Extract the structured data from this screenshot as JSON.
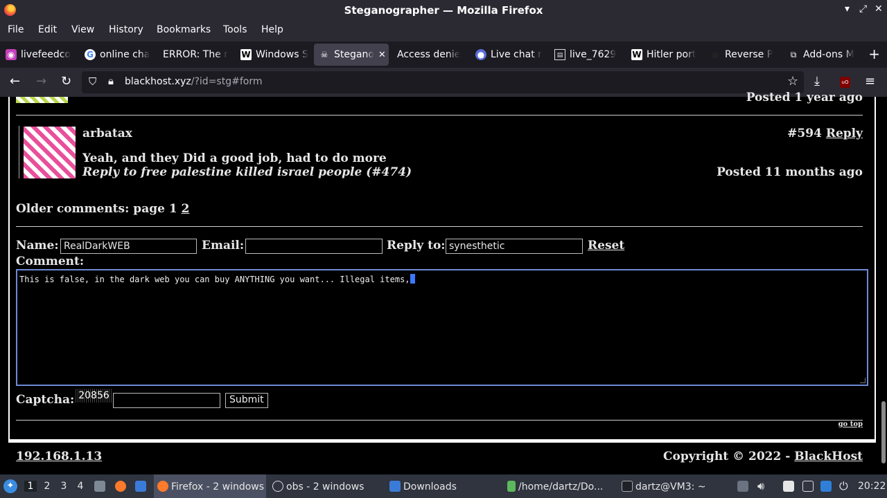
{
  "window": {
    "title": "Steganographer — Mozilla Firefox",
    "controls": [
      "▾",
      "⤢",
      "✕"
    ]
  },
  "menu": [
    "File",
    "Edit",
    "View",
    "History",
    "Bookmarks",
    "Tools",
    "Help"
  ],
  "tabs": [
    {
      "label": "livefeedco",
      "icon": "live-feed-icon"
    },
    {
      "label": "online cha",
      "icon": "google-icon"
    },
    {
      "label": "ERROR: The r",
      "icon": "none"
    },
    {
      "label": "Windows S",
      "icon": "wikipedia-icon"
    },
    {
      "label": "Stegano",
      "icon": "skull-icon",
      "active": true,
      "close": "✕"
    },
    {
      "label": "Access denie",
      "icon": "none"
    },
    {
      "label": "Live chat r",
      "icon": "chat-icon"
    },
    {
      "label": "live_7629",
      "icon": "page-icon"
    },
    {
      "label": "Hitler port",
      "icon": "wikipedia-icon"
    },
    {
      "label": "Reverse P",
      "icon": "user-icon"
    },
    {
      "label": "Add-ons M",
      "icon": "puzzle-icon"
    }
  ],
  "new_tab": "+",
  "url": {
    "host": "blackhost.xyz",
    "path": "/?id=stg#form"
  },
  "prev_post": {
    "posted": "Posted 1 year ago"
  },
  "post": {
    "author": "arbatax",
    "number": "#594",
    "reply": "Reply",
    "body": "Yeah, and they Did a good job, had to do more",
    "reply_to": "Reply to free palestine killed israel people (#474)",
    "posted": "Posted 11 months ago"
  },
  "pagination": {
    "label": "Older comments: page 1",
    "link": "2"
  },
  "form": {
    "name_label": "Name:",
    "name_value": "RealDarkWEB",
    "email_label": "Email:",
    "email_value": "",
    "replyto_label": "Reply to:",
    "replyto_value": "synesthetic",
    "reset": "Reset",
    "comment_label": "Comment:",
    "comment_text": "This is false, in the dark web you can buy ANYTHING you want... Illegal items,",
    "captcha_label": "Captcha:",
    "captcha_code": "20856",
    "captcha_value": "",
    "submit": "Submit",
    "go_top": "go top"
  },
  "footer": {
    "ip": "192.168.1.13",
    "copyright": "Copyright © 2022 -",
    "brand": "BlackHost"
  },
  "taskbar": {
    "workspaces": [
      "1",
      "2",
      "3",
      "4"
    ],
    "windows": [
      {
        "label": "Firefox - 2 windows"
      },
      {
        "label": "obs - 2 windows"
      },
      {
        "label": "Downloads"
      },
      {
        "label": "/home/dartz/Do..."
      },
      {
        "label": "dartz@VM3: ~"
      }
    ],
    "clock": "20:22"
  }
}
